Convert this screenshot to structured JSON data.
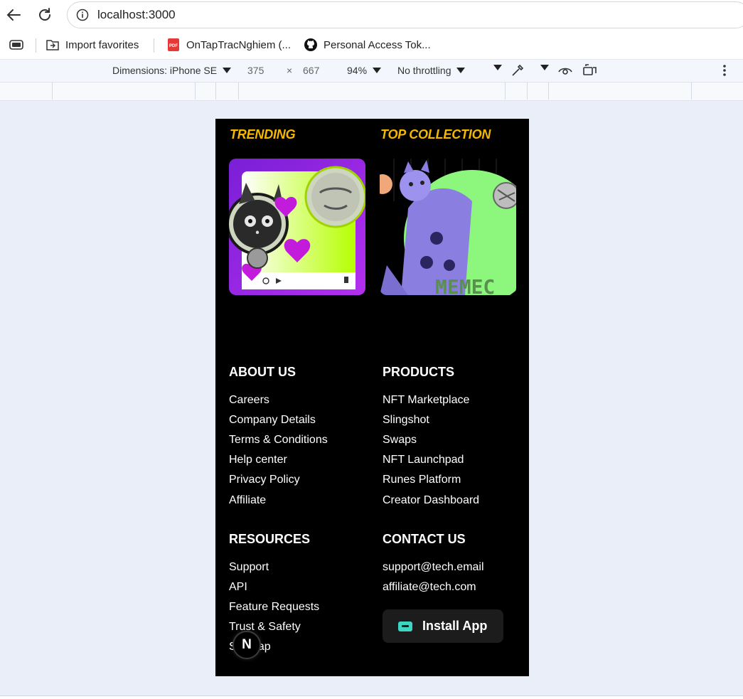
{
  "browser": {
    "url": "localhost:3000",
    "bookmarks": [
      "Import favorites",
      "OnTapTracNghiem (...",
      "Personal Access Tok..."
    ]
  },
  "devtools": {
    "dimensions_label": "Dimensions: iPhone SE",
    "width": "375",
    "times": "×",
    "height": "667",
    "zoom": "94%",
    "throttling": "No throttling"
  },
  "page": {
    "trending_title": "TRENDING",
    "top_collection_title": "TOP COLLECTION",
    "card_overlay_text": "MEMEC",
    "about": {
      "title": "ABOUT US",
      "links": [
        "Careers",
        "Company Details",
        "Terms & Conditions",
        "Help center",
        "Privacy Policy",
        "Affiliate"
      ]
    },
    "products": {
      "title": "PRODUCTS",
      "links": [
        "NFT Marketplace",
        "Slingshot",
        "Swaps",
        "NFT Launchpad",
        "Runes Platform",
        "Creator Dashboard"
      ]
    },
    "resources": {
      "title": "RESOURCES",
      "links": [
        "Support",
        "API",
        "Feature Requests",
        "Trust & Safety",
        "Sitemap"
      ]
    },
    "contact": {
      "title": "CONTACT US",
      "emails": [
        "support@tech.email",
        "affiliate@tech.com"
      ],
      "install_label": "Install App"
    },
    "n_badge": "N"
  }
}
